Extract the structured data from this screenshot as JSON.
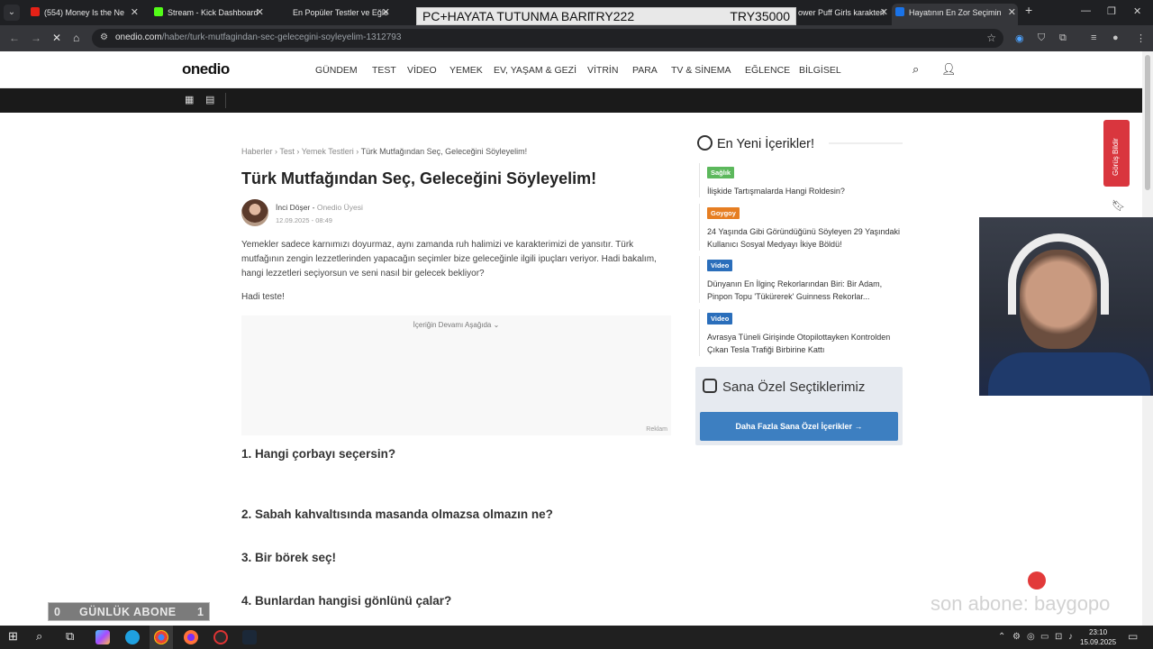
{
  "browser": {
    "tabs": [
      {
        "label": "(554) Money Is the Ne",
        "favicon_color": "#e62117"
      },
      {
        "label": "Stream - Kick Dashboard",
        "favicon_color": "#53fc18"
      },
      {
        "label": "En Popüler Testler ve Eğle",
        "favicon_color": "#000000"
      },
      {
        "label": "ower Puff Girls karakterl",
        "favicon_color": "#000000"
      },
      {
        "label": "Hayatının En Zor Seçimin",
        "favicon_color": "#1a73e8"
      }
    ],
    "url_domain": "onedio.com",
    "url_path": "/haber/turk-mutfagindan-sec-gelecegini-soyleyelim-1312793",
    "new_tab_icon": "plus-icon",
    "window_controls": [
      "minimize-icon",
      "restore-icon",
      "close-icon"
    ]
  },
  "overlay_bar": {
    "left": "PC+HAYATA TUTUNMA BARI",
    "mid": "TRY222",
    "right": "TRY35000"
  },
  "site": {
    "logo": "onedio",
    "nav": [
      "GÜNDEM",
      "TEST",
      "VİDEO",
      "YEMEK",
      "EV, YAŞAM & GEZİ",
      "VİTRİN",
      "PARA",
      "TV & SİNEMA",
      "EĞLENCE",
      "BİLGİSEL"
    ]
  },
  "article": {
    "breadcrumbs": [
      "Haberler",
      "Test",
      "Yemek Testleri",
      "Türk Mutfağından Seç, Geleceğini Söyleyelim!"
    ],
    "title": "Türk Mutfağından Seç, Geleceğini Söyleyelim!",
    "author": "İnci Döşer",
    "author_role": "Onedio Üyesi",
    "date": "12.09.2025 - 08:49",
    "intro": "Yemekler sadece karnımızı doyurmaz, aynı zamanda ruh halimizi ve karakterimizi de yansıtır. Türk mutfağının zengin lezzetlerinden yapacağın seçimler bize geleceğinle ilgili ipuçları veriyor. Hadi bakalım, hangi lezzetleri seçiyorsun ve seni nasıl bir gelecek bekliyor?",
    "cta": "Hadi teste!",
    "ad_more": "İçeriğin Devamı Aşağıda",
    "ad_label": "Reklam",
    "questions": [
      "1. Hangi çorbayı seçersin?",
      "2. Sabah kahvaltısında masanda olmazsa olmazın ne?",
      "3. Bir börek seç!",
      "4. Bunlardan hangisi gönlünü çalar?"
    ]
  },
  "sidebar": {
    "latest_title": "En Yeni İçerikler!",
    "items": [
      {
        "tag": "Sağlık",
        "tag_color": "#5cb85c",
        "text": "İlişkide Tartışmalarda Hangi Roldesin?"
      },
      {
        "tag": "Goygoy",
        "tag_color": "#e67e22",
        "text": "24 Yaşında Gibi Göründüğünü Söyleyen 29 Yaşındaki Kullanıcı Sosyal Medyayı İkiye Böldü!"
      },
      {
        "tag": "Video",
        "tag_color": "#2a6ebb",
        "text": "Dünyanın En İlginç Rekorlarından Biri: Bir Adam, Pinpon Topu 'Tükürerek' Guinness Rekorlar..."
      },
      {
        "tag": "Video",
        "tag_color": "#2a6ebb",
        "text": "Avrasya Tüneli Girişinde Otopilottayken Kontrolden Çıkan Tesla Trafiği Birbirine Kattı"
      }
    ],
    "special_title": "Sana Özel Seçtiklerimiz",
    "special_button": "Daha Fazla Sana Özel İçerikler",
    "feedback": "Görüş Bildir"
  },
  "stream": {
    "sub_left": "0",
    "sub_label": "GÜNLÜK ABONE",
    "sub_right": "1",
    "last_sub": "son abone: baygopo"
  },
  "taskbar": {
    "time": "23:10",
    "date": "15.09.2025"
  }
}
